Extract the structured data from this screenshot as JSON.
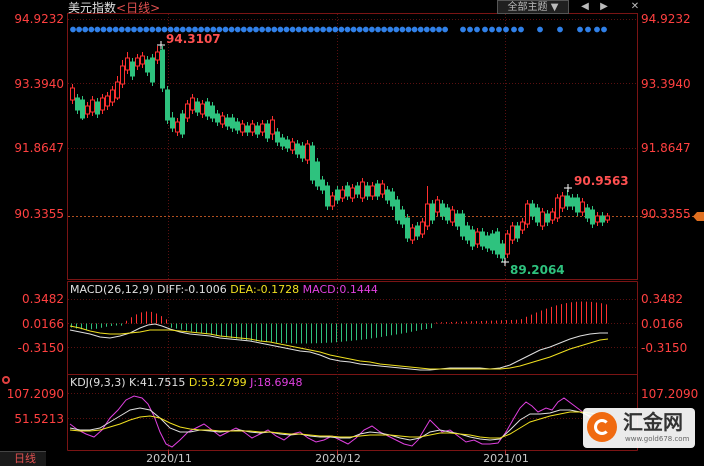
{
  "header": {
    "symbol": "美元指数",
    "period_control": "<日线>",
    "theme_button": "全部主题",
    "theme_arrow": "▼",
    "back_icon": "◀",
    "forward_icon": "▶",
    "close_icon": "✕"
  },
  "footer": {
    "period_tab": "日线"
  },
  "watermark": {
    "brand": "汇金网",
    "url": "www.gold678.com"
  },
  "chart_data": [
    {
      "type": "candlestick",
      "panel": "price",
      "title": "美元指数",
      "period": "日线",
      "y_ticks": [
        "94.9232",
        "93.3940",
        "91.8647",
        "90.3355"
      ],
      "ylim": [
        88.7,
        95.2
      ],
      "x_ticks": [
        "2020/11",
        "2020/12",
        "2021/01"
      ],
      "annotations": {
        "high": "94.3107",
        "low": "89.2064",
        "recent_high": "90.9563"
      },
      "last_value": 90.3355,
      "colors": {
        "up": "#ff3030",
        "down": "#2ec27e",
        "marker_dots": "#3080e8"
      }
    },
    {
      "type": "line",
      "panel": "macd",
      "header": {
        "name": "MACD(26,12,9)",
        "diff": "DIFF:-0.1006",
        "dea": "DEA:-0.1728",
        "macd": "MACD:0.1444"
      },
      "y_ticks": [
        "0.3482",
        "0.0166",
        "-0.3150"
      ],
      "series": [
        {
          "name": "DIFF",
          "color": "#e0e0e0"
        },
        {
          "name": "DEA",
          "color": "#f0e020"
        },
        {
          "name": "MACD",
          "color": "#e040e0"
        }
      ]
    },
    {
      "type": "line",
      "panel": "kdj",
      "header": {
        "name": "KDJ(9,3,3)",
        "k": "K:41.7515",
        "d": "D:53.2799",
        "j": "J:18.6948"
      },
      "y_ticks": [
        "107.2090",
        "51.5213"
      ],
      "series": [
        {
          "name": "K",
          "color": "#e0e0e0"
        },
        {
          "name": "D",
          "color": "#f0e020"
        },
        {
          "name": "J",
          "color": "#e040e0"
        }
      ]
    }
  ]
}
